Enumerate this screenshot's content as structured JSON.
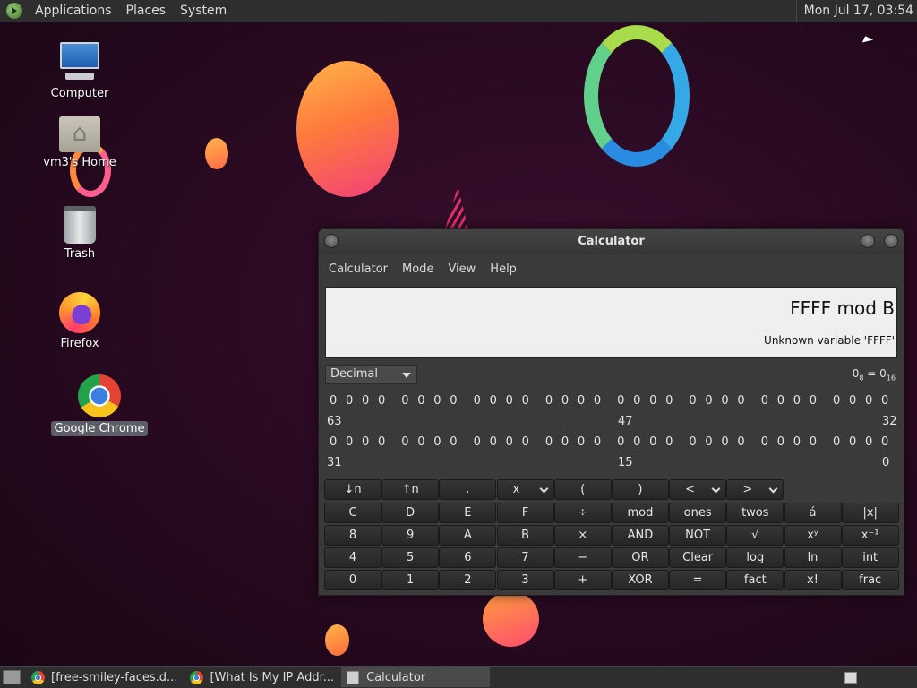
{
  "top_panel": {
    "menus": [
      "Applications",
      "Places",
      "System"
    ],
    "clock": "Mon Jul 17, 03:54"
  },
  "desktop_icons": {
    "computer": "Computer",
    "home": "vm3's Home",
    "trash": "Trash",
    "firefox": "Firefox",
    "chrome": "Google Chrome"
  },
  "calculator": {
    "title": "Calculator",
    "menu": [
      "Calculator",
      "Mode",
      "View",
      "Help"
    ],
    "display": {
      "expression": "FFFF mod B",
      "status": "Unknown variable 'FFFF'"
    },
    "base_select": "Decimal",
    "conversion": {
      "a": "0",
      "a_sub": "8",
      "eq": " = ",
      "b": "0",
      "b_sub": "16"
    },
    "bits": {
      "row1_groups": [
        "0000",
        "0000",
        "0000",
        "0000",
        "0000",
        "0000",
        "0000",
        "0000"
      ],
      "row1_labels": [
        "63",
        "47",
        "32"
      ],
      "row2_groups": [
        "0000",
        "0000",
        "0000",
        "0000",
        "0000",
        "0000",
        "0000",
        "0000"
      ],
      "row2_labels": [
        "31",
        "15",
        "0"
      ]
    },
    "shift_row": [
      "↓n",
      "↑n",
      ".",
      "x",
      "(",
      ")",
      "<",
      ">"
    ],
    "rows": [
      [
        "C",
        "D",
        "E",
        "F",
        "÷",
        "mod",
        "ones",
        "twos",
        "á",
        "|x|"
      ],
      [
        "8",
        "9",
        "A",
        "B",
        "×",
        "AND",
        "NOT",
        "√",
        "xʸ",
        "x⁻¹"
      ],
      [
        "4",
        "5",
        "6",
        "7",
        "−",
        "OR",
        "Clear",
        "log",
        "ln",
        "int"
      ],
      [
        "0",
        "1",
        "2",
        "3",
        "+",
        "XOR",
        "=",
        "fact",
        "x!",
        "frac"
      ]
    ]
  },
  "taskbar": {
    "tasks": [
      "[free-smiley-faces.d...",
      "[What Is My IP Addr...",
      "Calculator"
    ]
  }
}
